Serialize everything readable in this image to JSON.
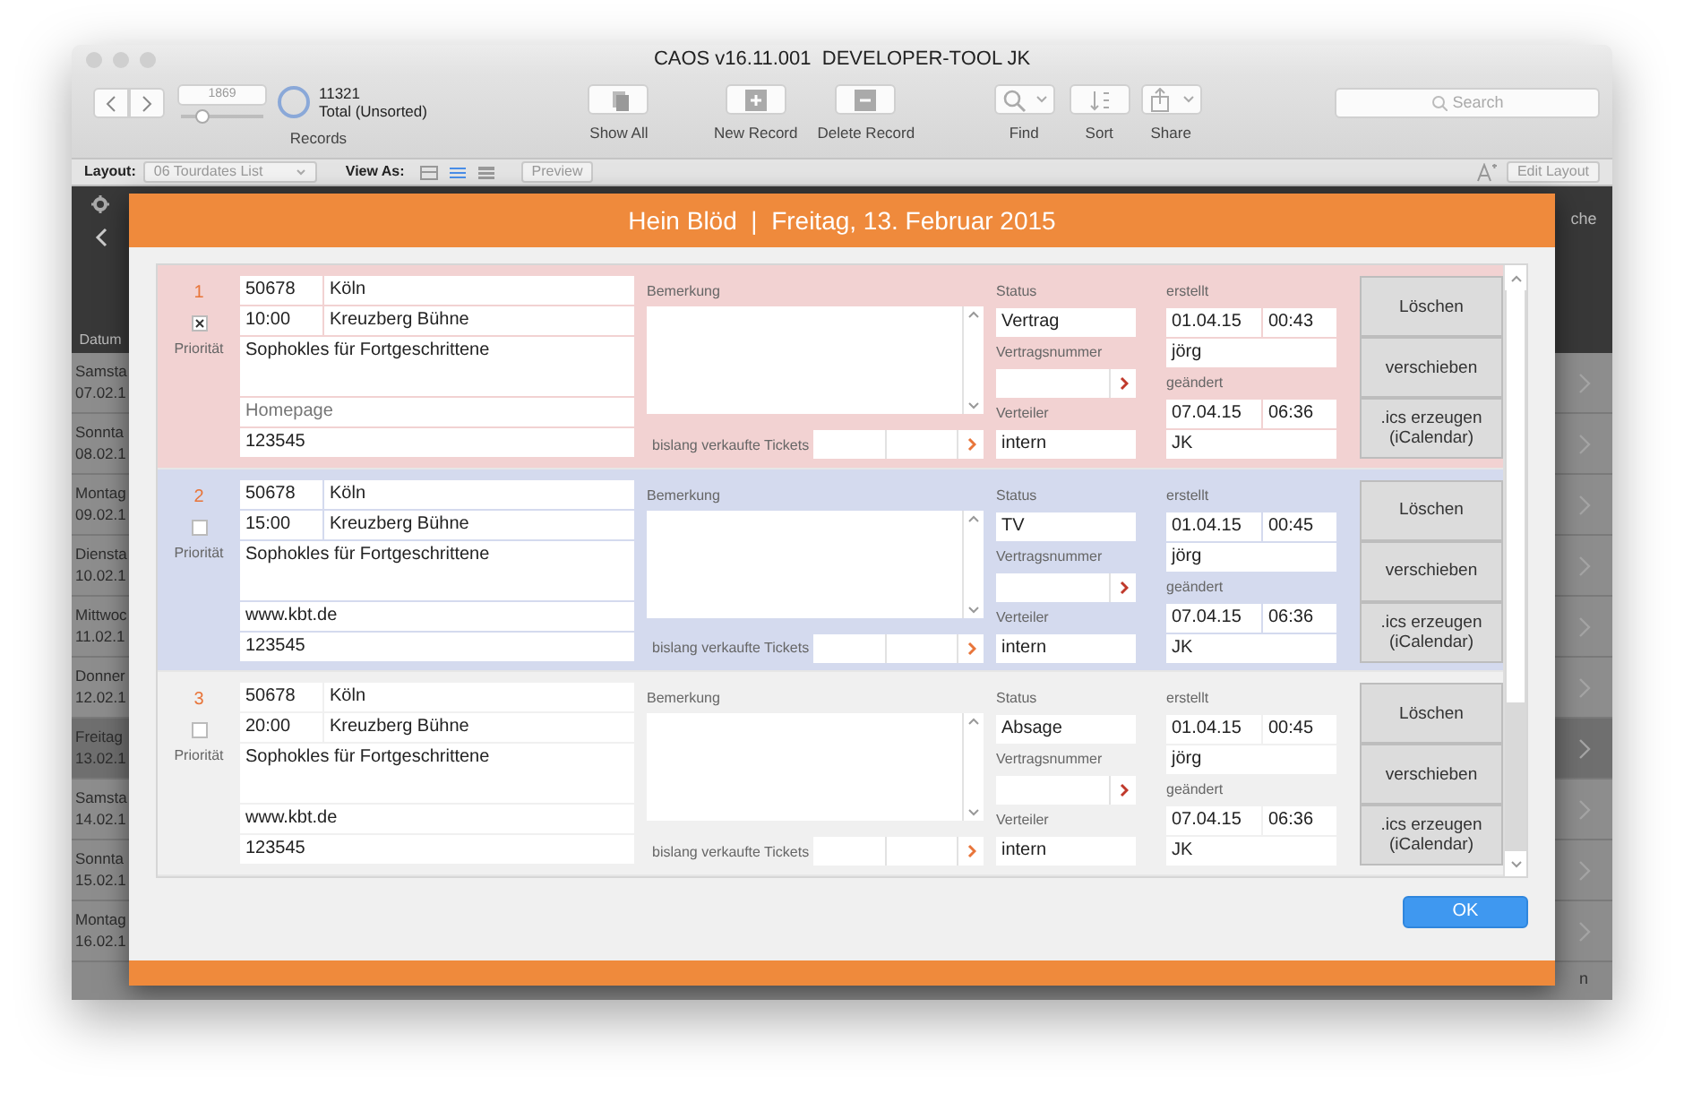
{
  "window": {
    "title": "CAOS v16.11.001  DEVELOPER-TOOL JK"
  },
  "toolbar": {
    "record_number": "1869",
    "record_slider": {
      "level": 0.25
    },
    "found_count": "11321",
    "found_label": "Total (Unsorted)",
    "records_label": "Records",
    "buttons": [
      {
        "label": "Show All",
        "kind": "showall"
      },
      {
        "label": "New Record",
        "kind": "new"
      },
      {
        "label": "Delete Record",
        "kind": "delete"
      },
      {
        "label": "Find",
        "kind": "find"
      },
      {
        "label": "Sort",
        "kind": "sort"
      },
      {
        "label": "Share",
        "kind": "share"
      }
    ],
    "search": {
      "placeholder": "Search"
    }
  },
  "layout_bar": {
    "layout_label": "Layout:",
    "layout_value": "06 Tourdates List",
    "view_as_label": "View As:",
    "views": [
      {
        "kind": "form",
        "selected": false
      },
      {
        "kind": "list",
        "selected": true
      },
      {
        "kind": "table",
        "selected": false
      }
    ],
    "preview_button": "Preview",
    "edit_layout_button": "Edit Layout"
  },
  "background": {
    "column_1_header": "Datum",
    "column_2_header": "che",
    "footer_text": "n",
    "rows": [
      {
        "day": "Samsta",
        "date": "07.02.1",
        "selected": false
      },
      {
        "day": "Sonnta",
        "date": "08.02.1",
        "selected": false
      },
      {
        "day": "Montag",
        "date": "09.02.1",
        "selected": false
      },
      {
        "day": "Diensta",
        "date": "10.02.1",
        "selected": false
      },
      {
        "day": "Mittwoc",
        "date": "11.02.1",
        "selected": false
      },
      {
        "day": "Donner",
        "date": "12.02.1",
        "selected": false
      },
      {
        "day": "Freitag",
        "date": "13.02.1",
        "selected": true
      },
      {
        "day": "Samsta",
        "date": "14.02.1",
        "selected": false
      },
      {
        "day": "Sonnta",
        "date": "15.02.1",
        "selected": false
      },
      {
        "day": "Montag",
        "date": "16.02.1",
        "selected": false
      }
    ]
  },
  "dialog": {
    "title": "Hein Blöd  |  Freitag, 13. Februar 2015",
    "ok_button": "OK",
    "records": [
      {
        "number": "1",
        "color": "#f2d2d2",
        "priority": true,
        "priority_label": "Priorität",
        "plz": "50678",
        "city": "Köln",
        "time": "10:00",
        "venue": "Kreuzberg Bühne",
        "event": "Sophokles für Fortgeschrittene",
        "homepage": {
          "placeholder": "Homepage"
        },
        "id": "123545",
        "remark_label": "Bemerkung",
        "tickets_label": "bislang verkaufte Tickets",
        "status_label": "Status",
        "status": "Vertrag",
        "contract_label": "Vertragsnummer",
        "distributor_label": "Verteiler",
        "distributor": "intern",
        "created_label": "erstellt",
        "created_date": "01.04.15",
        "created_time": "00:43",
        "created_by": "jörg",
        "changed_label": "geändert",
        "changed_date": "07.04.15",
        "changed_time": "06:36",
        "changed_by": "JK",
        "buttons": [
          "Löschen",
          "verschieben",
          ".ics erzeugen (iCalendar)"
        ]
      },
      {
        "number": "2",
        "color": "#d4daee",
        "priority": false,
        "priority_label": "Priorität",
        "plz": "50678",
        "city": "Köln",
        "time": "15:00",
        "venue": "Kreuzberg Bühne",
        "event": "Sophokles für Fortgeschrittene",
        "homepage": {
          "value": "www.kbt.de"
        },
        "id": "123545",
        "remark_label": "Bemerkung",
        "tickets_label": "bislang verkaufte Tickets",
        "status_label": "Status",
        "status": "TV",
        "contract_label": "Vertragsnummer",
        "distributor_label": "Verteiler",
        "distributor": "intern",
        "created_label": "erstellt",
        "created_date": "01.04.15",
        "created_time": "00:45",
        "created_by": "jörg",
        "changed_label": "geändert",
        "changed_date": "07.04.15",
        "changed_time": "06:36",
        "changed_by": "JK",
        "buttons": [
          "Löschen",
          "verschieben",
          ".ics erzeugen (iCalendar)"
        ]
      },
      {
        "number": "3",
        "color": "#f0f0f0",
        "priority": false,
        "priority_label": "Priorität",
        "plz": "50678",
        "city": "Köln",
        "time": "20:00",
        "venue": "Kreuzberg Bühne",
        "event": "Sophokles für Fortgeschrittene",
        "homepage": {
          "value": "www.kbt.de"
        },
        "id": "123545",
        "remark_label": "Bemerkung",
        "tickets_label": "bislang verkaufte Tickets",
        "status_label": "Status",
        "status": "Absage",
        "contract_label": "Vertragsnummer",
        "distributor_label": "Verteiler",
        "distributor": "intern",
        "created_label": "erstellt",
        "created_date": "01.04.15",
        "created_time": "00:45",
        "created_by": "jörg",
        "changed_label": "geändert",
        "changed_date": "07.04.15",
        "changed_time": "06:36",
        "changed_by": "JK",
        "buttons": [
          "Löschen",
          "verschieben",
          ".ics erzeugen (iCalendar)"
        ]
      }
    ]
  }
}
